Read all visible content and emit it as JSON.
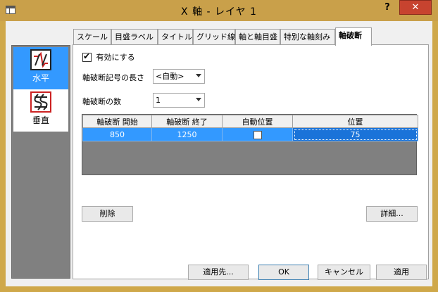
{
  "window": {
    "title": "X 軸 - レイヤ 1",
    "help_label": "?",
    "close_label": "✕"
  },
  "orientation": {
    "items": [
      {
        "label": "水平",
        "icon": "horizontal-break-icon",
        "selected": true
      },
      {
        "label": "垂直",
        "icon": "vertical-break-icon",
        "selected": false
      }
    ]
  },
  "tabs": [
    {
      "label": "スケール"
    },
    {
      "label": "目盛ラベル"
    },
    {
      "label": "タイトル"
    },
    {
      "label": "グリッド線"
    },
    {
      "label": "軸と軸目盛"
    },
    {
      "label": "特別な軸刻み"
    },
    {
      "label": "軸破断"
    }
  ],
  "active_tab": "軸破断",
  "form": {
    "enable_label": "有効にする",
    "enable_checked": true,
    "symbol_length_label": "軸破断記号の長さ",
    "symbol_length_value": "<自動>",
    "count_label": "軸破断の数",
    "count_value": "1"
  },
  "table": {
    "headers": [
      "軸破断 開始",
      "軸破断 終了",
      "自動位置",
      "位置"
    ],
    "rows": [
      {
        "start": "850",
        "end": "1250",
        "auto": false,
        "position": "75"
      }
    ]
  },
  "buttons": {
    "delete": "削除",
    "details": "詳細...",
    "apply_to": "適用先...",
    "ok": "OK",
    "cancel": "キャンセル",
    "apply": "適用"
  },
  "colors": {
    "titlebar": "#c9a04a",
    "selection": "#3399ff",
    "close": "#c7432f"
  }
}
